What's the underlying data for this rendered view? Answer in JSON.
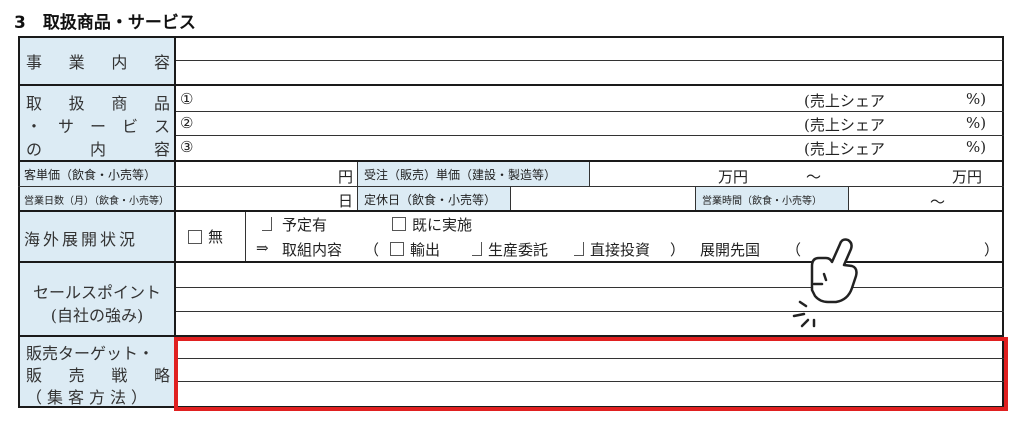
{
  "section": {
    "title": "3　取扱商品・サービス"
  },
  "rows": {
    "business": {
      "label_chars": [
        "事",
        "業",
        "内",
        "容"
      ]
    },
    "products": {
      "label_lines": [
        [
          "取",
          "扱",
          "商",
          "品"
        ],
        [
          "・",
          "サ",
          "ー",
          "ビ",
          "ス"
        ],
        [
          "の",
          "内",
          "容"
        ]
      ],
      "items": [
        {
          "marker": "①",
          "share": "(売上シェア",
          "pct": "%)"
        },
        {
          "marker": "②",
          "share": "(売上シェア",
          "pct": "%)"
        },
        {
          "marker": "③",
          "share": "(売上シェア",
          "pct": "%)"
        }
      ]
    },
    "unit_price": {
      "label": "客単価（飲食・小売等）",
      "unit": "円",
      "order_label": "受注（販売）単価（建設・製造等）",
      "unit2": "万円",
      "tilde": "〜",
      "unit3": "万円"
    },
    "business_days": {
      "label": "営業日数（月）（飲食・小売等）",
      "unit": "日",
      "holiday_label": "定休日（飲食・小売等）",
      "hours_label": "営業時間（飲食・小売等）",
      "tilde": "〜"
    },
    "overseas": {
      "label": "海外展開状況",
      "none": "無",
      "planned": "予定有",
      "implemented": "既に実施",
      "arrow": "⇒",
      "content_label": "取組内容",
      "paren_open": "（",
      "export": "輸出",
      "production": "生産委託",
      "investment": "直接投資",
      "paren_close": "）",
      "destination_label": "展開先国",
      "dest_open": "（",
      "dest_close": "）"
    },
    "sales_point": {
      "label_line1": "セールスポイント",
      "label_line2": "(自社の強み)"
    },
    "target": {
      "label_line1": "販売ターゲット・",
      "label_line2_chars": [
        "販",
        "売",
        "戦",
        "略"
      ],
      "label_line3": "（集客方法）"
    }
  },
  "overlay": {
    "pointer": "hand-pointer-icon",
    "highlight_color": "#e02020"
  }
}
